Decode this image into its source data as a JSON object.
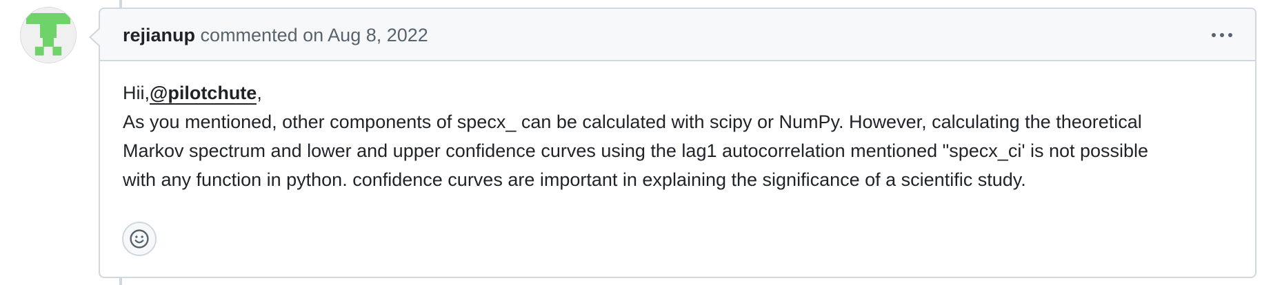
{
  "comment": {
    "author": "rejianup",
    "action": "commented on",
    "timestamp": "Aug 8, 2022",
    "body": {
      "greeting": "Hii,",
      "mention": "@pilotchute",
      "greeting_suffix": ",",
      "paragraph_line_1": "As you mentioned, other components of specx_ can be calculated with scipy or NumPy. However, calculating the theoretical",
      "paragraph_line_2": "Markov spectrum and lower and upper confidence curves using the lag1 autocorrelation mentioned \"specx_ci' is not possible",
      "paragraph_line_3": "with any function in python. confidence curves are important in explaining the significance of a scientific study."
    }
  },
  "icons": {
    "avatar": "identicon-avatar",
    "more_actions": "kebab-horizontal-icon",
    "reaction": "smiley-icon"
  },
  "colors": {
    "avatar_green": "#6fd36a",
    "header_bg": "#f6f8fa",
    "border": "#d0d7de",
    "muted_text": "#59636e"
  }
}
